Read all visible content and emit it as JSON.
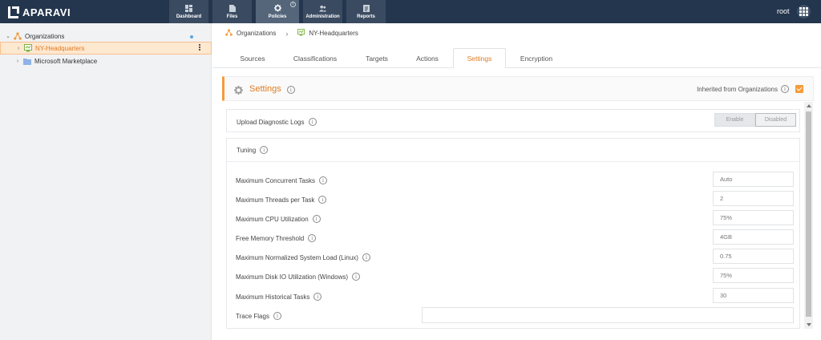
{
  "app": {
    "logo_text": "APARAVI",
    "user": "root"
  },
  "nav": [
    {
      "label": "Dashboard",
      "icon": "dashboard-icon"
    },
    {
      "label": "Files",
      "icon": "file-icon"
    },
    {
      "label": "Policies",
      "icon": "gear-icon",
      "active": true,
      "badge": "i"
    },
    {
      "label": "Administration",
      "icon": "users-icon"
    },
    {
      "label": "Reports",
      "icon": "report-icon"
    }
  ],
  "sidebar": {
    "items": [
      {
        "label": "Organizations",
        "icon": "organization-icon"
      },
      {
        "label": "NY-Headquarters",
        "icon": "server-icon",
        "selected": true
      },
      {
        "label": "Microsoft Marketplace",
        "icon": "folder-icon"
      }
    ]
  },
  "breadcrumb": {
    "root": "Organizations",
    "current": "NY-Headquarters"
  },
  "tabs": [
    "Sources",
    "Classifications",
    "Targets",
    "Actions",
    "Settings",
    "Encryption"
  ],
  "panel": {
    "title": "Settings",
    "inherited_label": "Inherited from Organizations",
    "inherited_checked": true
  },
  "diagnostic": {
    "label": "Upload Diagnostic Logs",
    "enable_label": "Enable",
    "disable_label": "Disabled"
  },
  "tuning": {
    "label": "Tuning",
    "fields": [
      {
        "label": "Maximum Concurrent Tasks",
        "placeholder": "Auto"
      },
      {
        "label": "Maximum Threads per Task",
        "placeholder": "2"
      },
      {
        "label": "Maximum CPU Utilization",
        "placeholder": "75%"
      },
      {
        "label": "Free Memory Threshold",
        "placeholder": "4GB"
      },
      {
        "label": "Maximum Normalized System Load (Linux)",
        "placeholder": "0.75"
      },
      {
        "label": "Maximum Disk IO Utilization (Windows)",
        "placeholder": "75%"
      },
      {
        "label": "Maximum Historical Tasks",
        "placeholder": "30"
      }
    ],
    "trace_label": "Trace Flags"
  },
  "colors": {
    "accent": "#e07b21",
    "header_bg": "#24364d"
  }
}
